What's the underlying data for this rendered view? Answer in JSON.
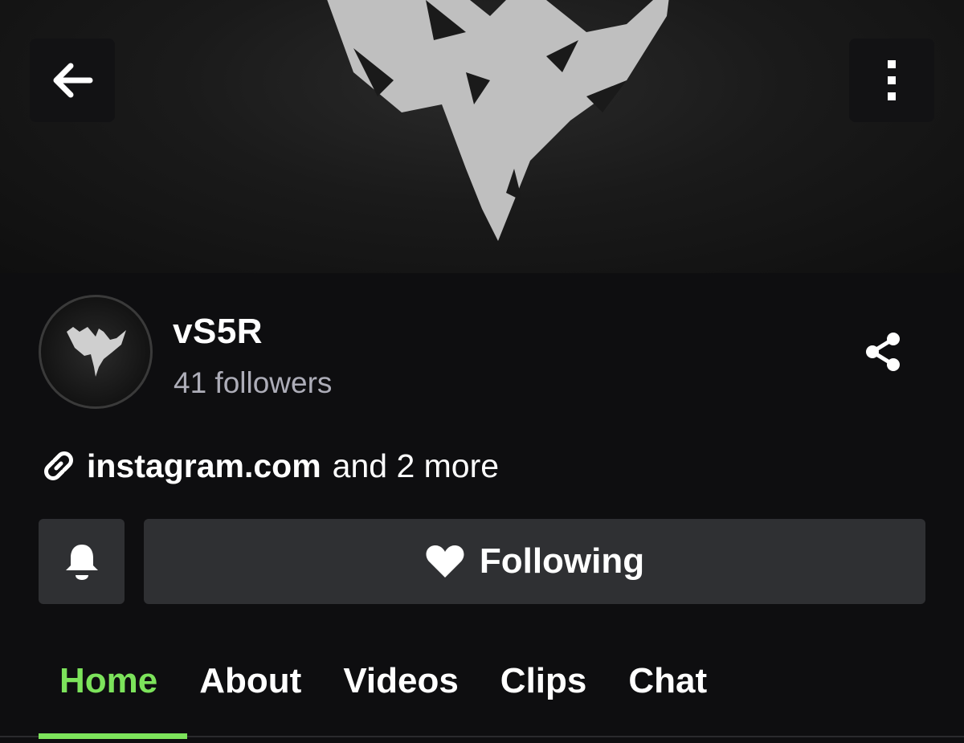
{
  "banner": {
    "back_icon": "arrow-left-icon",
    "more_icon": "vertical-dots-icon"
  },
  "channel": {
    "name": "vS5R",
    "followers": "41 followers",
    "avatar_icon": "phoenix-logo"
  },
  "share_icon": "share-icon",
  "links": {
    "icon": "link-icon",
    "main": "instagram.com",
    "more": "and 2 more"
  },
  "actions": {
    "bell_icon": "bell-icon",
    "follow_icon": "heart-icon",
    "follow_label": "Following"
  },
  "tabs": [
    {
      "label": "Home",
      "active": true
    },
    {
      "label": "About"
    },
    {
      "label": "Videos"
    },
    {
      "label": "Clips"
    },
    {
      "label": "Chat"
    }
  ],
  "colors": {
    "accent": "#7ce35b",
    "background": "#0e0e10",
    "button_bg": "#2f3033",
    "secondary_text": "#adadb8"
  }
}
